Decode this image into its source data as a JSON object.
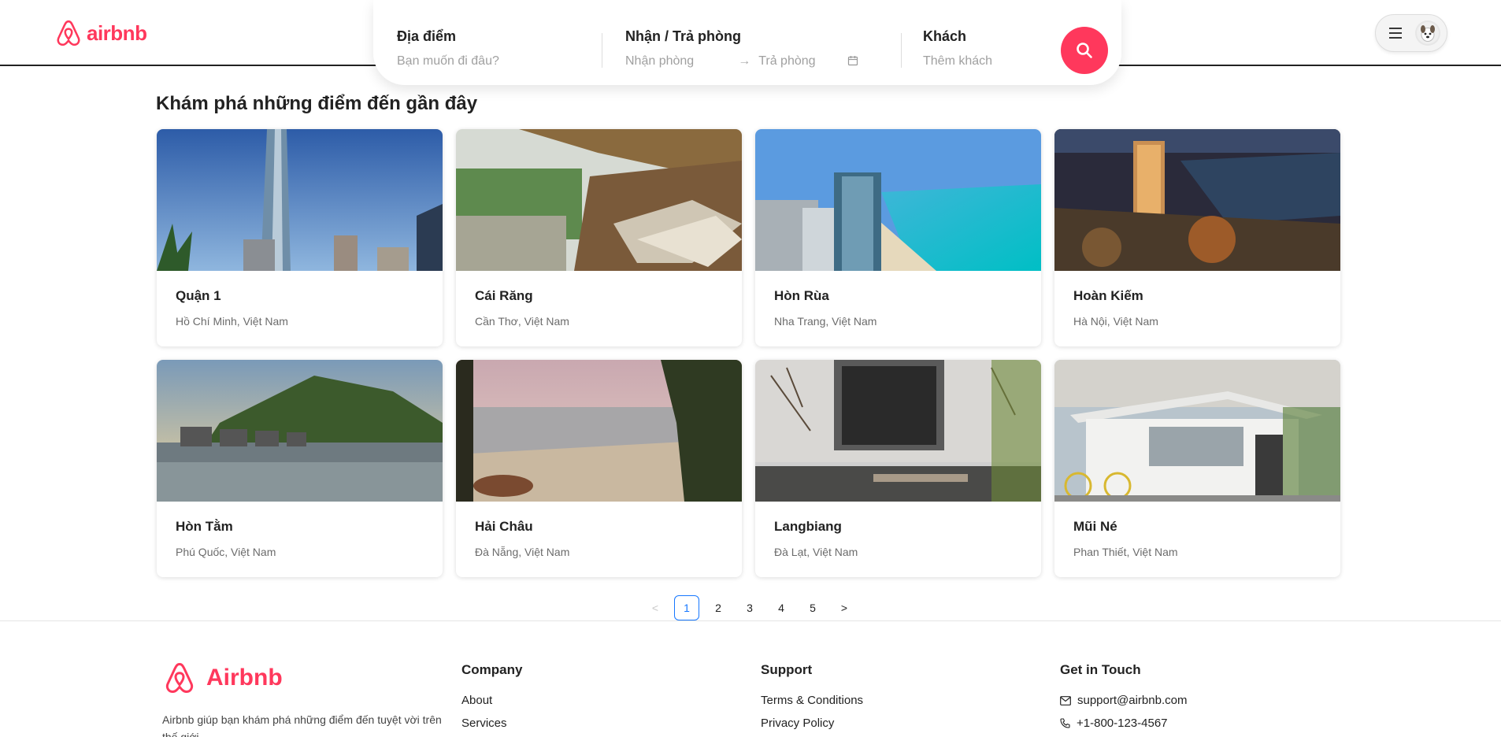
{
  "header": {
    "logo_text": "airbnb",
    "search": {
      "location_label": "Địa điểm",
      "location_placeholder": "Bạn muốn đi đâu?",
      "dates_label": "Nhận / Trả phòng",
      "checkin_placeholder": "Nhận phòng",
      "checkout_placeholder": "Trả phòng",
      "guests_label": "Khách",
      "guests_placeholder": "Thêm khách"
    }
  },
  "main": {
    "title": "Khám phá những điểm đến gần đây",
    "destinations": [
      {
        "name": "Quận 1",
        "location": "Hồ Chí Minh, Việt Nam"
      },
      {
        "name": "Cái Răng",
        "location": "Cần Thơ, Việt Nam"
      },
      {
        "name": "Hòn Rùa",
        "location": "Nha Trang, Việt Nam"
      },
      {
        "name": "Hoàn Kiếm",
        "location": "Hà Nội, Việt Nam"
      },
      {
        "name": "Hòn Tằm",
        "location": "Phú Quốc, Việt Nam"
      },
      {
        "name": "Hải Châu",
        "location": "Đà Nẵng, Việt Nam"
      },
      {
        "name": "Langbiang",
        "location": "Đà Lạt, Việt Nam"
      },
      {
        "name": "Mũi Né",
        "location": "Phan Thiết, Việt Nam"
      }
    ]
  },
  "pagination": {
    "prev": "<",
    "pages": [
      "1",
      "2",
      "3",
      "4",
      "5"
    ],
    "current": "1",
    "next": ">"
  },
  "footer": {
    "logo_text": "Airbnb",
    "description": "Airbnb giúp bạn khám phá những điểm đến tuyệt vời trên thế giới",
    "company": {
      "title": "Company",
      "links": [
        "About",
        "Services"
      ]
    },
    "support": {
      "title": "Support",
      "links": [
        "Terms & Conditions",
        "Privacy Policy"
      ]
    },
    "contact": {
      "title": "Get in Touch",
      "email": "support@airbnb.com",
      "phone": "+1-800-123-4567"
    }
  },
  "colors": {
    "brand": "#ff385c",
    "active_page": "#1677ff"
  }
}
